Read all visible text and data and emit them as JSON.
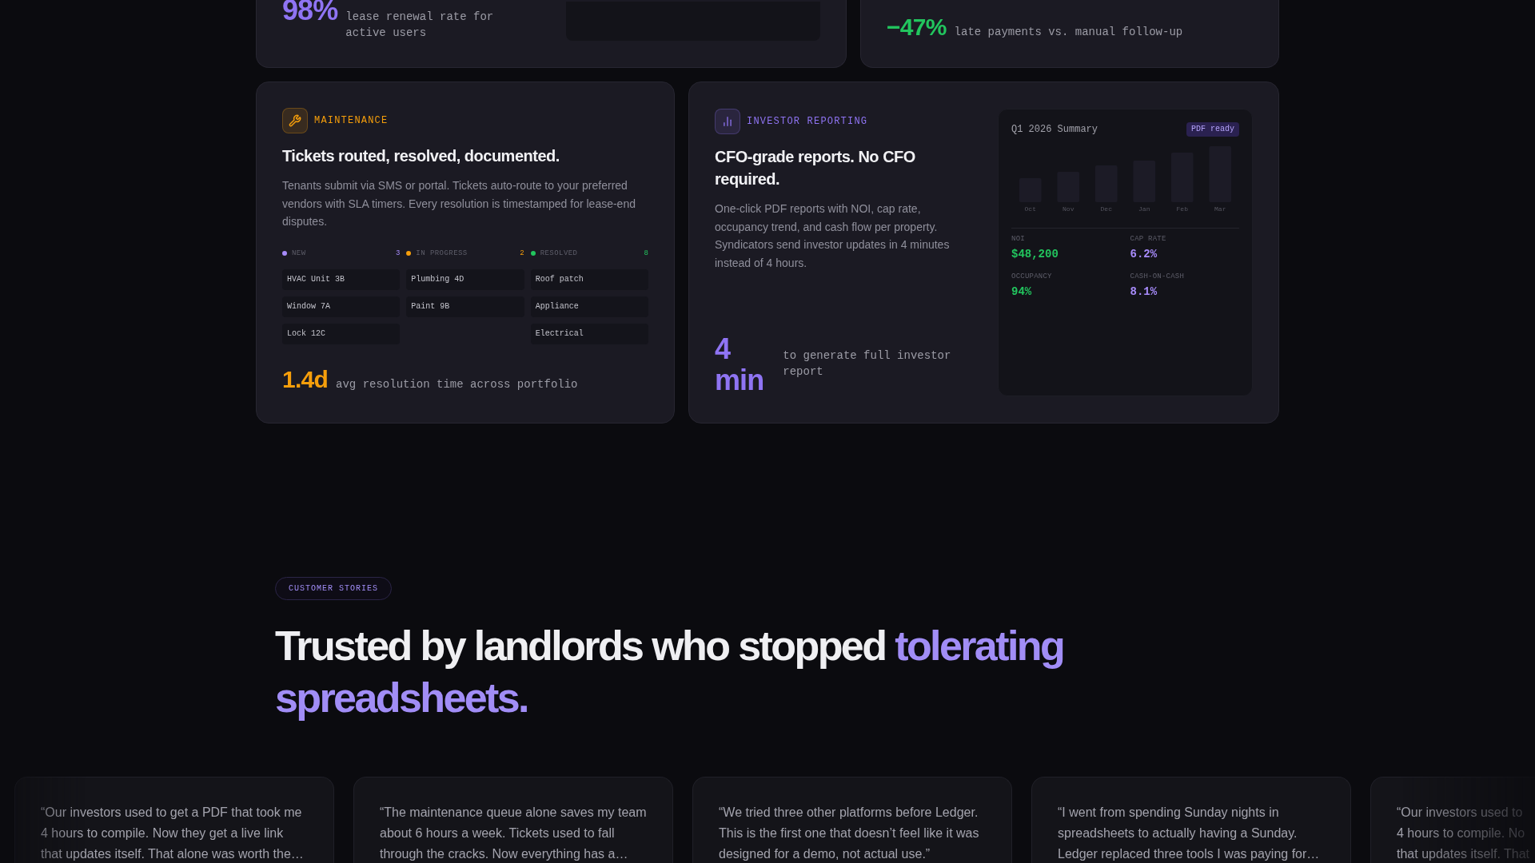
{
  "feature_rows": [
    {
      "cards": [
        {
          "kind": "preview_stat",
          "stat": "98%",
          "description": "lease renewal rate for active users",
          "color": "#8f74f3"
        },
        {
          "kind": "stat",
          "stat": "−47%",
          "description": "late payments vs. manual follow-up",
          "color": "#22c55e"
        }
      ]
    },
    {
      "cards": [
        {
          "kind": "kanban",
          "tag": "MAINTENANCE",
          "color": "#f59e0b",
          "title": "Tickets routed, resolved, documented.",
          "body": "Tenants submit via SMS or portal. Tickets auto-route to your preferred vendors with SLA timers. Every resolution is timestamped for lease-end disputes.",
          "columns": [
            {
              "label": "NEW",
              "count": "3",
              "color": "#a78bfa",
              "tickets": [
                "HVAC Unit 3B",
                "Window 7A",
                "Lock 12C"
              ]
            },
            {
              "label": "IN PROGRESS",
              "count": "2",
              "color": "#f59e0b",
              "tickets": [
                "Plumbing 4D",
                "Paint 9B"
              ]
            },
            {
              "label": "RESOLVED",
              "count": "8",
              "color": "#22c55e",
              "tickets": [
                "Roof patch",
                "Appliance",
                "Electrical"
              ]
            }
          ],
          "stat": "1.4d",
          "description": "avg resolution time across portfolio"
        },
        {
          "kind": "report",
          "tag": "INVESTOR REPORTING",
          "color": "#8f74f3",
          "title": "CFO-grade reports. No CFO required.",
          "body": "One-click PDF reports with NOI, cap rate, occupancy trend, and cash flow per property. Syndicators send investor updates in 4 minutes instead of 4 hours.",
          "stat": "4 min",
          "description": "to generate full investor report",
          "summary": {
            "title": "Q1 2026 Summary",
            "badge": "PDF ready",
            "months": [
              "Oct",
              "Nov",
              "Dec",
              "Jan",
              "Feb",
              "Mar"
            ],
            "metrics": [
              {
                "label": "NOI",
                "value": "$48,200",
                "color": "#22c55e"
              },
              {
                "label": "CAP RATE",
                "value": "6.2%",
                "color": "#a78bfa"
              },
              {
                "label": "OCCUPANCY",
                "value": "94%",
                "color": "#22c55e"
              },
              {
                "label": "CASH-ON-CASH",
                "value": "8.1%",
                "color": "#a78bfa"
              }
            ]
          }
        }
      ]
    }
  ],
  "customer_stories": {
    "badge": "CUSTOMER STORIES",
    "heading": "Trusted by landlords who stopped",
    "heading_highlight": "tolerating spreadsheets."
  },
  "testimonials": [
    {
      "lines": [
        "“Our investors used to get a PDF that took me",
        "4 hours to compile. Now they get a live link",
        "that updates itself. That alone was worth the…"
      ]
    },
    {
      "lines": [
        "“The maintenance queue alone saves my team",
        "about 6 hours a week. Tickets used to fall",
        "through the cracks. Now everything has a…"
      ]
    },
    {
      "lines": [
        "“We tried three other platforms before Ledger.",
        "This is the first one that doesn’t feel like it was",
        "designed for a demo, not actual use.”"
      ]
    },
    {
      "lines": [
        "“I went from spending Sunday nights in",
        "spreadsheets to actually having a Sunday.",
        "Ledger replaced three tools I was paying for…"
      ]
    },
    {
      "lines": [
        "“Our investors used to",
        "4 hours to compile. No",
        "that updates itself. That"
      ]
    }
  ]
}
